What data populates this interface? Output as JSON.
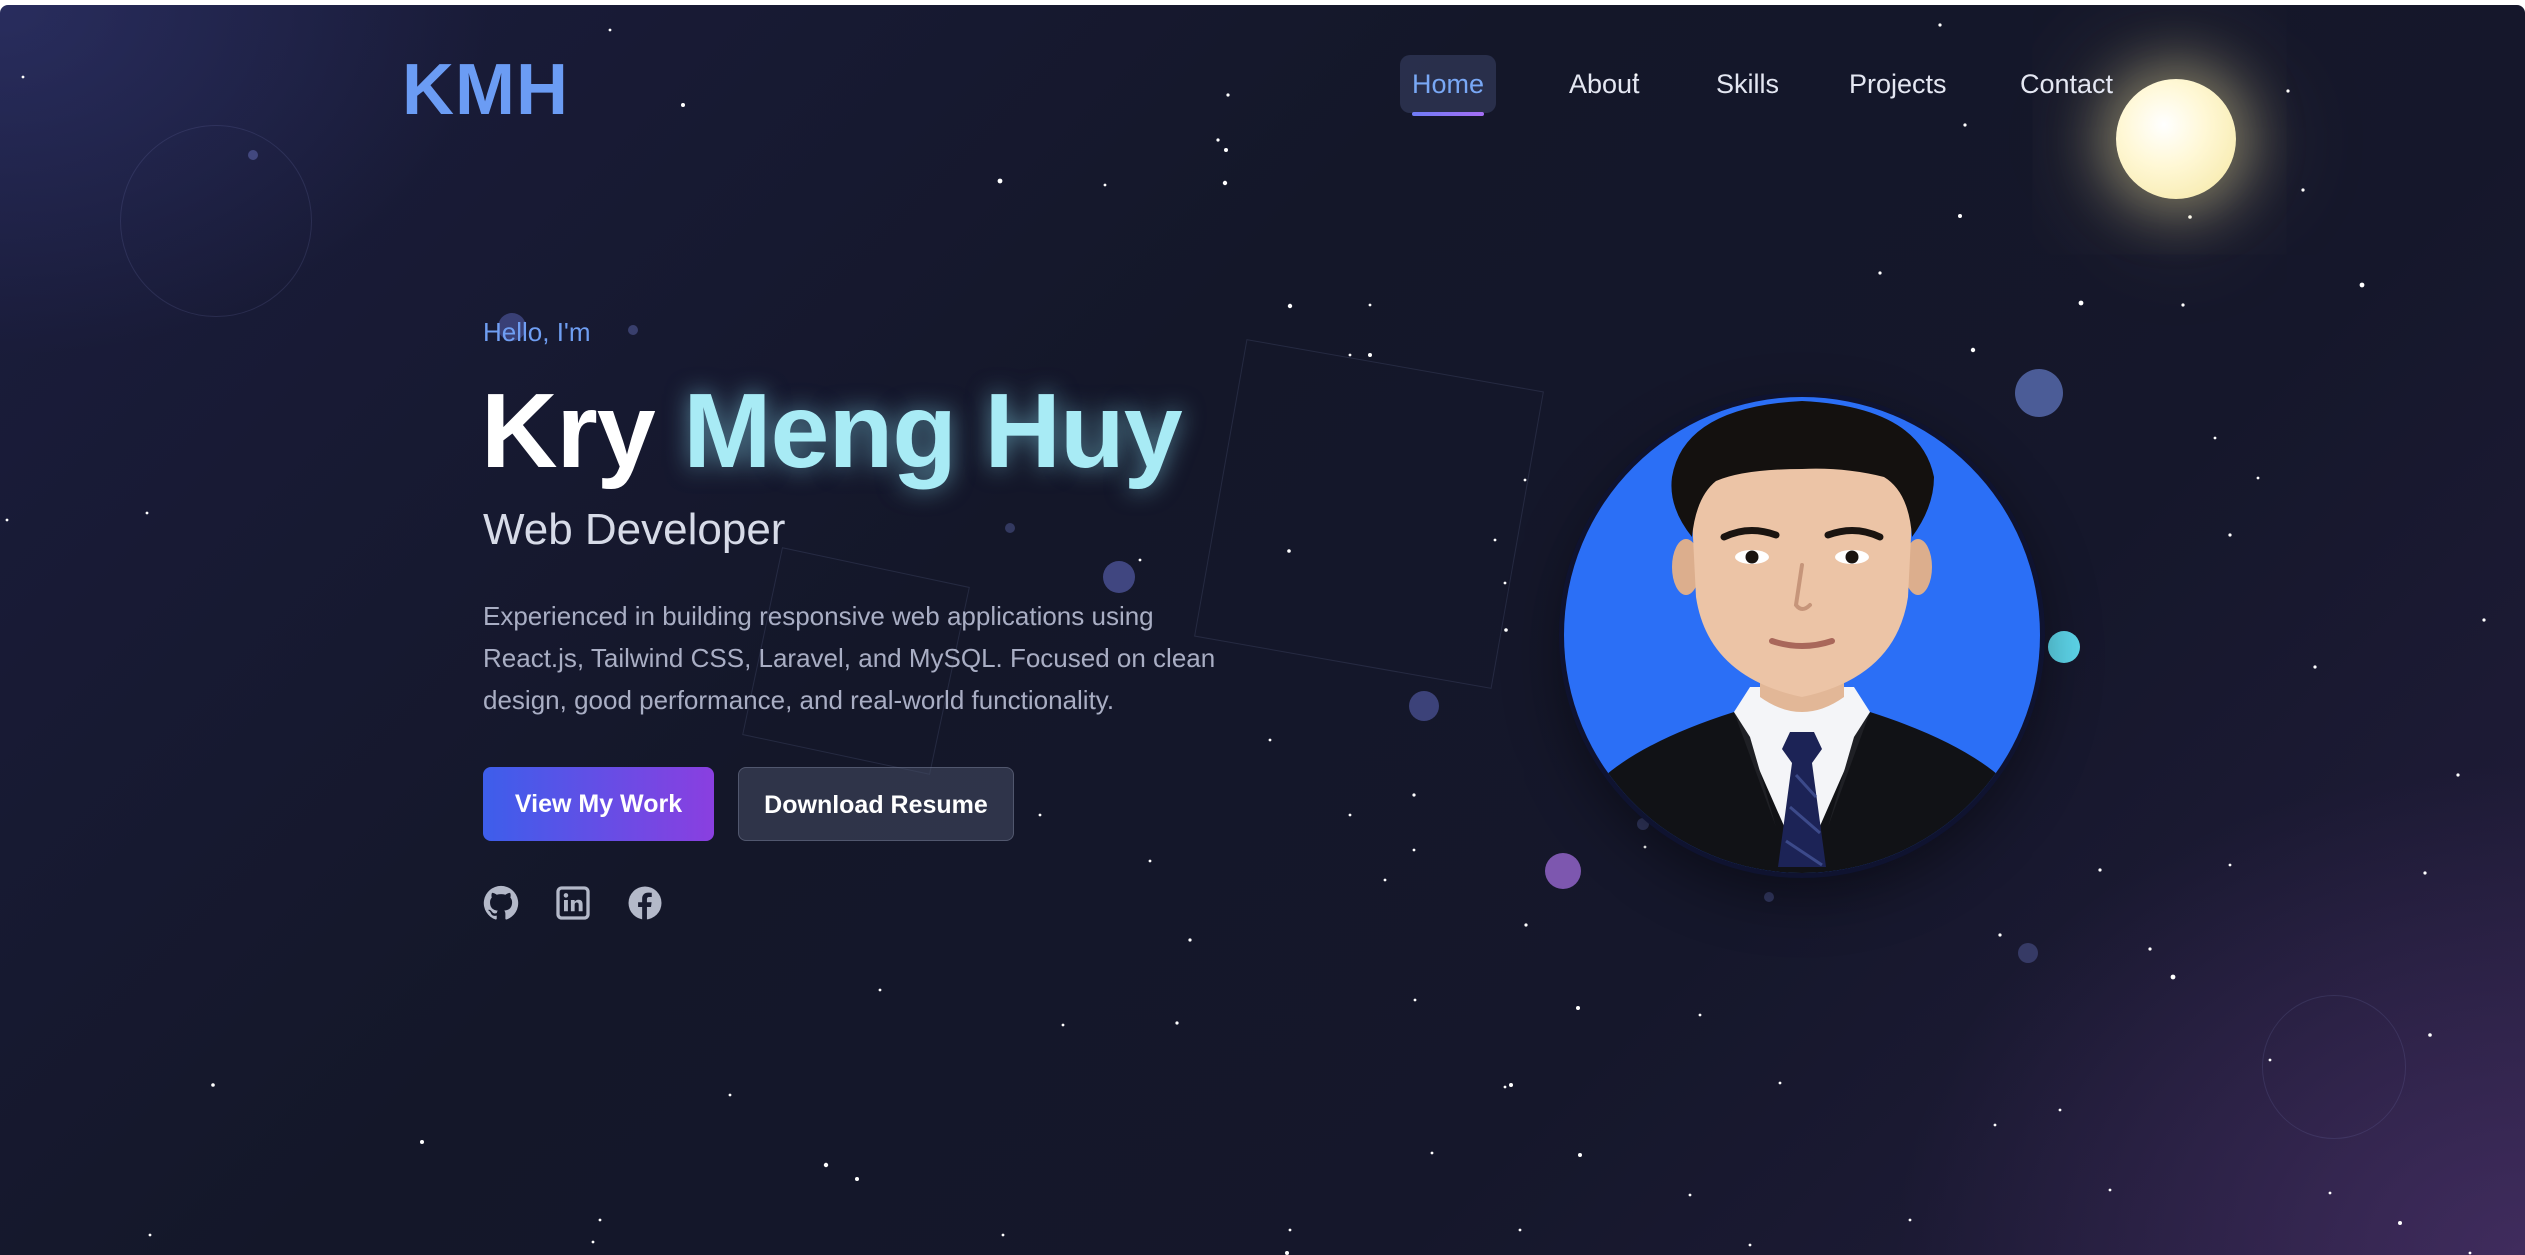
{
  "header": {
    "logo": "KMH",
    "nav": [
      {
        "label": "Home",
        "active": true
      },
      {
        "label": "About",
        "active": false
      },
      {
        "label": "Skills",
        "active": false
      },
      {
        "label": "Projects",
        "active": false
      },
      {
        "label": "Contact",
        "active": false
      }
    ]
  },
  "hero": {
    "greeting": "Hello, I'm",
    "first_name": "Kry",
    "last_name": "Meng Huy",
    "role": "Web Developer",
    "description": "Experienced in building responsive web applications using React.js, Tailwind CSS, Laravel, and MySQL. Focused on clean design, good performance, and real-world functionality.",
    "primary_button": "View My Work",
    "secondary_button": "Download Resume",
    "socials": [
      {
        "icon": "github-icon"
      },
      {
        "icon": "linkedin-icon"
      },
      {
        "icon": "facebook-icon"
      }
    ]
  },
  "profile_photo": {
    "icon": "portrait-photo",
    "background_color": "#2b6ff6"
  },
  "colors": {
    "accent": "#6b9cf4",
    "name_highlight": "#a8ebf5",
    "button_gradient_start": "#3d5eeb",
    "button_gradient_end": "#8a3fe0"
  }
}
